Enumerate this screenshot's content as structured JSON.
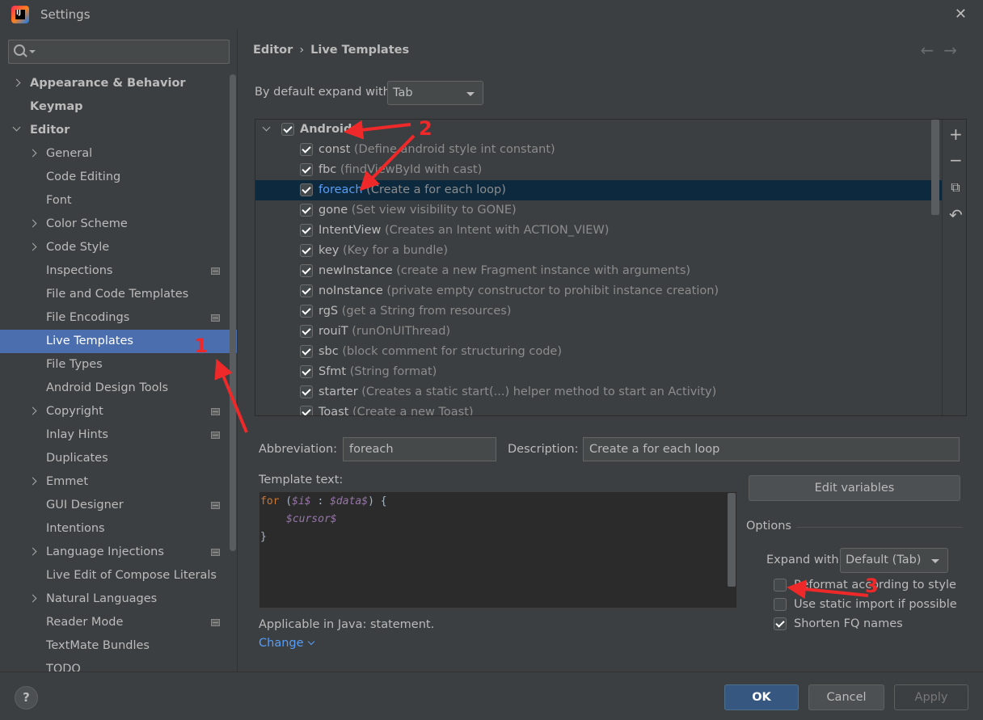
{
  "window": {
    "title": "Settings",
    "close_glyph": "✕",
    "app_icon_letter": "IJ"
  },
  "search": {
    "placeholder": "",
    "value": ""
  },
  "sidebar": {
    "items": [
      {
        "label": "Appearance & Behavior",
        "indent": 0,
        "chevron": "right",
        "bold": true,
        "badge": false,
        "selected": false
      },
      {
        "label": "Keymap",
        "indent": 0,
        "chevron": "none",
        "bold": true,
        "badge": false,
        "selected": false
      },
      {
        "label": "Editor",
        "indent": 0,
        "chevron": "down",
        "bold": true,
        "badge": false,
        "selected": false
      },
      {
        "label": "General",
        "indent": 1,
        "chevron": "right",
        "bold": false,
        "badge": false,
        "selected": false
      },
      {
        "label": "Code Editing",
        "indent": 1,
        "chevron": "none",
        "bold": false,
        "badge": false,
        "selected": false
      },
      {
        "label": "Font",
        "indent": 1,
        "chevron": "none",
        "bold": false,
        "badge": false,
        "selected": false
      },
      {
        "label": "Color Scheme",
        "indent": 1,
        "chevron": "right",
        "bold": false,
        "badge": false,
        "selected": false
      },
      {
        "label": "Code Style",
        "indent": 1,
        "chevron": "right",
        "bold": false,
        "badge": false,
        "selected": false
      },
      {
        "label": "Inspections",
        "indent": 1,
        "chevron": "none",
        "bold": false,
        "badge": true,
        "selected": false
      },
      {
        "label": "File and Code Templates",
        "indent": 1,
        "chevron": "none",
        "bold": false,
        "badge": false,
        "selected": false
      },
      {
        "label": "File Encodings",
        "indent": 1,
        "chevron": "none",
        "bold": false,
        "badge": true,
        "selected": false
      },
      {
        "label": "Live Templates",
        "indent": 1,
        "chevron": "none",
        "bold": false,
        "badge": false,
        "selected": true
      },
      {
        "label": "File Types",
        "indent": 1,
        "chevron": "none",
        "bold": false,
        "badge": false,
        "selected": false
      },
      {
        "label": "Android Design Tools",
        "indent": 1,
        "chevron": "none",
        "bold": false,
        "badge": false,
        "selected": false
      },
      {
        "label": "Copyright",
        "indent": 1,
        "chevron": "right",
        "bold": false,
        "badge": true,
        "selected": false
      },
      {
        "label": "Inlay Hints",
        "indent": 1,
        "chevron": "none",
        "bold": false,
        "badge": true,
        "selected": false
      },
      {
        "label": "Duplicates",
        "indent": 1,
        "chevron": "none",
        "bold": false,
        "badge": false,
        "selected": false
      },
      {
        "label": "Emmet",
        "indent": 1,
        "chevron": "right",
        "bold": false,
        "badge": false,
        "selected": false
      },
      {
        "label": "GUI Designer",
        "indent": 1,
        "chevron": "none",
        "bold": false,
        "badge": true,
        "selected": false
      },
      {
        "label": "Intentions",
        "indent": 1,
        "chevron": "none",
        "bold": false,
        "badge": false,
        "selected": false
      },
      {
        "label": "Language Injections",
        "indent": 1,
        "chevron": "right",
        "bold": false,
        "badge": true,
        "selected": false
      },
      {
        "label": "Live Edit of Compose Literals",
        "indent": 1,
        "chevron": "none",
        "bold": false,
        "badge": false,
        "selected": false
      },
      {
        "label": "Natural Languages",
        "indent": 1,
        "chevron": "right",
        "bold": false,
        "badge": false,
        "selected": false
      },
      {
        "label": "Reader Mode",
        "indent": 1,
        "chevron": "none",
        "bold": false,
        "badge": true,
        "selected": false
      },
      {
        "label": "TextMate Bundles",
        "indent": 1,
        "chevron": "none",
        "bold": false,
        "badge": false,
        "selected": false
      },
      {
        "label": "TODO",
        "indent": 1,
        "chevron": "none",
        "bold": false,
        "badge": false,
        "selected": false
      }
    ]
  },
  "breadcrumb": {
    "parent": "Editor",
    "separator": "›",
    "current": "Live Templates"
  },
  "nav": {
    "back": "←",
    "forward": "→"
  },
  "expand_default": {
    "label": "By default expand with",
    "value": "Tab"
  },
  "templates": {
    "group": {
      "name": "Android",
      "checked": true
    },
    "items": [
      {
        "abbr": "const",
        "desc": "(Define android style int constant)",
        "checked": true,
        "selected": false
      },
      {
        "abbr": "fbc",
        "desc": "(findViewById with cast)",
        "checked": true,
        "selected": false
      },
      {
        "abbr": "foreach",
        "desc": "(Create a for each loop)",
        "checked": true,
        "selected": true
      },
      {
        "abbr": "gone",
        "desc": "(Set view visibility to GONE)",
        "checked": true,
        "selected": false
      },
      {
        "abbr": "IntentView",
        "desc": "(Creates an Intent with ACTION_VIEW)",
        "checked": true,
        "selected": false
      },
      {
        "abbr": "key",
        "desc": "(Key for a bundle)",
        "checked": true,
        "selected": false
      },
      {
        "abbr": "newInstance",
        "desc": "(create a new Fragment instance with arguments)",
        "checked": true,
        "selected": false
      },
      {
        "abbr": "noInstance",
        "desc": "(private empty constructor to prohibit instance creation)",
        "checked": true,
        "selected": false
      },
      {
        "abbr": "rgS",
        "desc": "(get a String from resources)",
        "checked": true,
        "selected": false
      },
      {
        "abbr": "rouiT",
        "desc": "(runOnUIThread)",
        "checked": true,
        "selected": false
      },
      {
        "abbr": "sbc",
        "desc": "(block comment for structuring code)",
        "checked": true,
        "selected": false
      },
      {
        "abbr": "Sfmt",
        "desc": "(String format)",
        "checked": true,
        "selected": false
      },
      {
        "abbr": "starter",
        "desc": "(Creates a static start(...) helper method to start an Activity)",
        "checked": true,
        "selected": false
      },
      {
        "abbr": "Toast",
        "desc": "(Create a new Toast)",
        "checked": true,
        "selected": false
      }
    ],
    "tools": {
      "add": "+",
      "remove": "−",
      "copy": "⧉",
      "restore": "↶"
    }
  },
  "abbreviation": {
    "label": "Abbreviation:",
    "value": "foreach"
  },
  "description": {
    "label": "Description:",
    "value": "Create a for each loop"
  },
  "template_text": {
    "label": "Template text:",
    "line1_kw": "for",
    "line1_a": " (",
    "line1_v1": "$i$",
    "line1_b": " : ",
    "line1_v2": "$data$",
    "line1_c": ") {",
    "line2_v": "$cursor$",
    "line3": "}"
  },
  "applicable": {
    "text": "Applicable in Java: statement.",
    "change_label": "Change"
  },
  "edit_variables": {
    "label": "Edit variables"
  },
  "options": {
    "title": "Options",
    "expand_label": "Expand with",
    "expand_value": "Default (Tab)",
    "reformat": {
      "label": "Reformat according to style",
      "checked": false
    },
    "static_import": {
      "label": "Use static import if possible",
      "checked": false
    },
    "shorten_fq": {
      "label": "Shorten FQ names",
      "checked": true
    }
  },
  "footer": {
    "help": "?",
    "ok": "OK",
    "cancel": "Cancel",
    "apply": "Apply"
  },
  "annotations": {
    "n1": "1",
    "n2": "2",
    "n3": "3",
    "color": "#ef2929"
  },
  "colors": {
    "background": "#3c3f41",
    "selection": "#4b6eaf",
    "list_selection": "#0d293e",
    "link": "#589df6",
    "primary_button": "#365880"
  }
}
